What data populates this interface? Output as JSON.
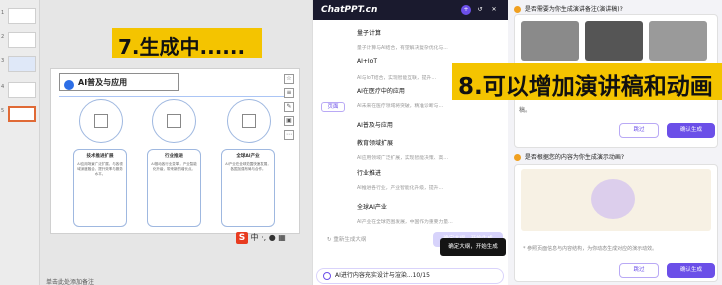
{
  "annotation_left": "7.生成中......",
  "annotation_right": "8.可以增加演讲稿和动画",
  "slide": {
    "title": "AI普及与应用",
    "cards": [
      {
        "title": "技术推进扩展",
        "body": "AI应用场景广泛扩展，与各领域深度融合，提升效率与服务水平。"
      },
      {
        "title": "行业推进",
        "body": "AI推动各行业变革，产业智能化升级，带来新的增长点。"
      },
      {
        "title": "全球AI产业",
        "body": "AI产业在全球范围快速发展，各国加强布局与合作。"
      }
    ]
  },
  "slide_numbers": [
    "1",
    "2",
    "3",
    "4",
    "5"
  ],
  "ime_items": [
    "中",
    "·,",
    "英"
  ],
  "ime_letter": "S",
  "notes_label": "单击此处添加备注",
  "mid": {
    "logo": "ChatPPT.cn",
    "outline": [
      {
        "text": "量子计算",
        "cls": "h"
      },
      {
        "text": "量子计算与AI结合，有望解决复杂优化与...",
        "cls": "sub"
      },
      {
        "text": "AI+IoT",
        "cls": "h"
      },
      {
        "text": "AI与IoT结合，实现智能互联，提升…",
        "cls": "sub"
      },
      {
        "text": "AI在医疗中的应用",
        "cls": "h"
      },
      {
        "text": "AI未来在医疗领域将突破，精准诊断与…",
        "cls": "sub"
      },
      {
        "text": "AI普及与应用",
        "cls": "h"
      },
      {
        "text": "教育领域扩展",
        "cls": "h"
      },
      {
        "text": "AI应用领域广泛扩展，实现智能决策、高…",
        "cls": "sub"
      },
      {
        "text": "行业推进",
        "cls": "h"
      },
      {
        "text": "AI推进各行业，产业智能化升级，提升…",
        "cls": "sub"
      },
      {
        "text": "全球AI产业",
        "cls": "h"
      },
      {
        "text": "AI产业在全球范围发展，中国作为重要力量…",
        "cls": "sub"
      }
    ],
    "section_pill": "页面",
    "rewrite": "↻ 重新生成大纲",
    "gen_button": "确定大纲，开始生成",
    "tip": "确定大纲，开始生成",
    "progress": "AI进行内容充实设计与渲染...10/15"
  },
  "right": {
    "q1": "是否需要为你生成演讲备注(演讲稿)?",
    "q2": "是否根据您的内容为你生成演示动画?",
    "note": "* 参照页面信息与内容结构，为你动态生成对应的演示动效。",
    "skip": "跳过",
    "ok": "确认生成",
    "partial": "稿。"
  },
  "colors": {
    "accent": "#6b4fe8",
    "annotation": "#f4c400",
    "slide_blue": "#2d6ee6"
  }
}
